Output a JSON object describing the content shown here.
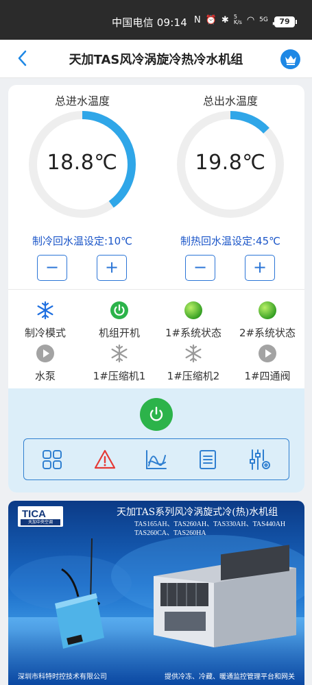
{
  "status_bar": {
    "carrier_time": "中国电信 09:14",
    "net_speed": "5 K/s",
    "signal": "5G",
    "battery": "79"
  },
  "nav": {
    "title": "天加TAS风冷涡旋冷热冷水机组"
  },
  "gauges": {
    "inlet": {
      "label": "总进水温度",
      "value": "18.8℃",
      "fill": 0.4
    },
    "outlet": {
      "label": "总出水温度",
      "value": "19.8℃",
      "fill": 0.13
    }
  },
  "setpoints": {
    "cooling": "制冷回水温设定:10℃",
    "heating": "制热回水温设定:45℃",
    "minus": "−",
    "plus": "+"
  },
  "status_items": [
    {
      "label": "制冷模式",
      "icon": "snowflake-icon"
    },
    {
      "label": "机组开机",
      "icon": "power-on-icon"
    },
    {
      "label": "1#系统状态",
      "icon": "green-indicator-icon"
    },
    {
      "label": "2#系统状态",
      "icon": "green-indicator-icon"
    },
    {
      "label": "水泵",
      "icon": "play-icon"
    },
    {
      "label": "1#压缩机1",
      "icon": "snowflake-icon"
    },
    {
      "label": "1#压缩机2",
      "icon": "snowflake-icon"
    },
    {
      "label": "1#四通阀",
      "icon": "play-icon"
    }
  ],
  "toolbar": [
    "grid-icon",
    "alarm-icon",
    "chart-icon",
    "list-icon",
    "settings-icon"
  ],
  "banner": {
    "brand": "TICA",
    "brand_sub": "天加中央空调",
    "headline": "天加TAS系列风冷涡旋式冷(热)水机组",
    "models_line1": "TAS165AH、TAS260AH、TAS330AH、TAS440AH",
    "models_line2": "TAS260CA、TAS260HA",
    "footer_left": "深圳市科特时控技术有限公司",
    "footer_right": "提供冷冻、冷藏、暖通监控管理平台和网关"
  },
  "colors": {
    "accent": "#2a74d6",
    "gauge_track": "#eeeeee",
    "gauge_fill": "#2fa6e8",
    "power_green": "#2cb34a",
    "panel_bg": "#dceef9",
    "alarm_red": "#e53935"
  }
}
